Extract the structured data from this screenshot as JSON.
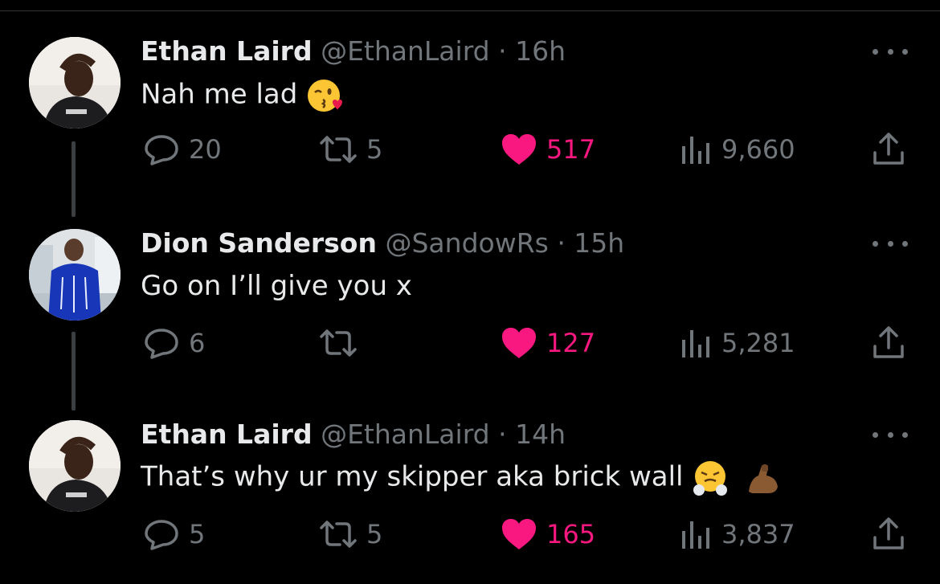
{
  "tweets": [
    {
      "name": "Ethan Laird",
      "handle": "@EthanLaird",
      "time": "· 16h",
      "text": "Nah me lad",
      "emojis": [
        "kissing-wink-emoji"
      ],
      "replies": "20",
      "reposts": "5",
      "likes": "517",
      "views": "9,660"
    },
    {
      "name": "Dion Sanderson",
      "handle": "@SandowRs",
      "time": "· 15h",
      "text": "Go on I’ll give you x",
      "emojis": [],
      "replies": "6",
      "reposts": "",
      "likes": "127",
      "views": "5,281"
    },
    {
      "name": "Ethan Laird",
      "handle": "@EthanLaird",
      "time": "· 14h",
      "text": "That’s why ur my skipper aka brick wall",
      "emojis": [
        "steam-nose-emoji",
        "flexed-biceps-emoji"
      ],
      "replies": "5",
      "reposts": "5",
      "likes": "165",
      "views": "3,837"
    }
  ],
  "colors": {
    "background": "#000000",
    "text": "#e7e9ea",
    "muted": "#71767b",
    "like": "#f91880"
  }
}
